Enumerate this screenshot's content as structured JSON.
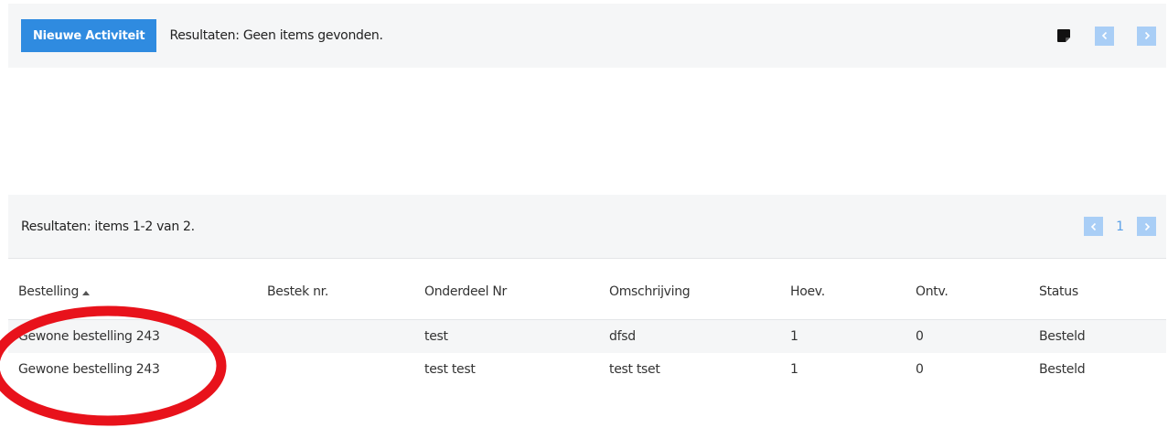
{
  "toolbar": {
    "new_activity_label": "Nieuwe Activiteit",
    "result_text": "Resultaten: Geen items gevonden."
  },
  "results_bar": {
    "result_text": "Resultaten: items 1-2 van 2.",
    "current_page": "1"
  },
  "table": {
    "columns": [
      "Bestelling",
      "Bestek nr.",
      "Onderdeel Nr",
      "Omschrijving",
      "Hoev.",
      "Ontv.",
      "Status"
    ],
    "sort_column": "Bestelling",
    "rows": [
      {
        "bestelling": "Gewone bestelling 243",
        "bestek_nr": "",
        "onderdeel_nr": "test",
        "omschrijving": "dfsd",
        "hoev": "1",
        "ontv": "0",
        "status": "Besteld"
      },
      {
        "bestelling": "Gewone bestelling 243",
        "bestek_nr": "",
        "onderdeel_nr": "test test",
        "omschrijving": "test tset",
        "hoev": "1",
        "ontv": "0",
        "status": "Besteld"
      }
    ]
  },
  "icons": {
    "note": "sticky-note-icon",
    "prev": "chevron-left-icon",
    "next": "chevron-right-icon",
    "sort": "sort-asc-icon"
  },
  "colors": {
    "primary": "#2f8be0",
    "pager": "#a9cef6",
    "bar_bg": "#f5f6f7",
    "annotation": "#e8121b"
  }
}
